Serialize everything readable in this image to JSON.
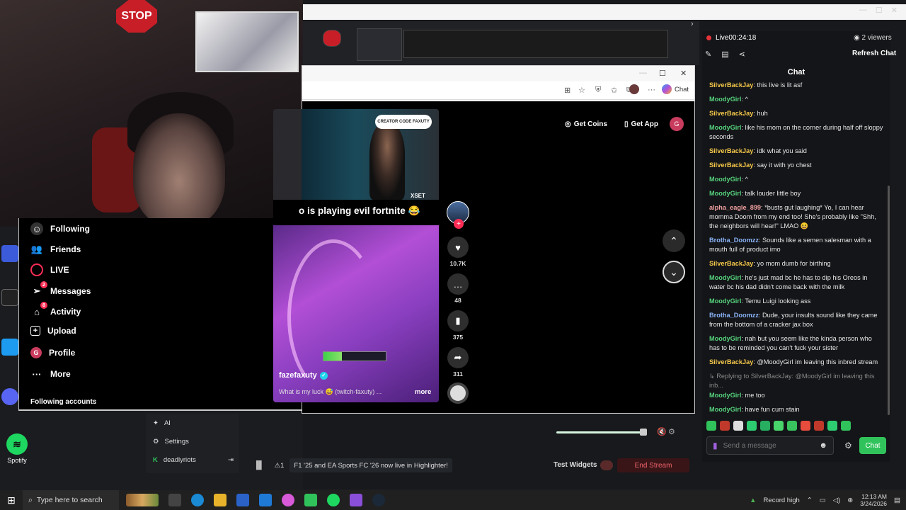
{
  "desktop": {
    "spotify_label": "Spotify",
    "webcam_sign": "STOP"
  },
  "stream": {
    "live_label": "Live",
    "live_time": "00:24:18",
    "viewers": "2 viewers",
    "refresh_label": "Refresh Chat",
    "chat_title": "Chat",
    "send_placeholder": "Send a message",
    "chat_button": "Chat",
    "test_widgets": "Test Widgets",
    "end_stream": "End Stream",
    "highlight_msg": "F1 '25 and EA Sports FC '26 now live in Highlighter!",
    "highlight_count": "1",
    "sidebar": {
      "ai_label": "AI",
      "settings_label": "Settings",
      "user_label": "deadlyriots"
    },
    "messages": [
      {
        "user": "SilverBackJay",
        "color": "#f5c84a",
        "text": "this live is lit asf"
      },
      {
        "user": "MoodyGirl",
        "color": "#55d27d",
        "text": "^"
      },
      {
        "user": "SilverBackJay",
        "color": "#f5c84a",
        "text": "huh"
      },
      {
        "user": "MoodyGirl",
        "color": "#55d27d",
        "text": "like his mom on the corner during half off sloppy seconds"
      },
      {
        "user": "SilverBackJay",
        "color": "#f5c84a",
        "text": "idk what you said"
      },
      {
        "user": "SilverBackJay",
        "color": "#f5c84a",
        "text": "say it with yo chest"
      },
      {
        "user": "MoodyGirl",
        "color": "#55d27d",
        "text": "^"
      },
      {
        "user": "MoodyGirl",
        "color": "#55d27d",
        "text": "talk louder little boy"
      },
      {
        "user": "alpha_eagle_899",
        "color": "#f0a0a0",
        "text": "*busts gut laughing* Yo, I can hear momma Doom from my end too! She's probably like \"Shh, the neighbors will hear!\" LMAO 😆"
      },
      {
        "user": "Brotha_Doomzz",
        "color": "#8ab4f8",
        "text": "Sounds like a semen salesman with a mouth full of product imo"
      },
      {
        "user": "SilverBackJay",
        "color": "#f5c84a",
        "text": "yo mom dumb for birthing"
      },
      {
        "user": "MoodyGirl",
        "color": "#55d27d",
        "text": "he's just mad bc he has to dip his Oreos in water bc his dad didn't come back with the milk"
      },
      {
        "user": "MoodyGirl",
        "color": "#55d27d",
        "text": "Temu Luigi looking ass"
      },
      {
        "user": "Brotha_Doomzz",
        "color": "#8ab4f8",
        "text": "Dude, your insults sound like they came from the bottom of a cracker jax box"
      },
      {
        "user": "MoodyGirl",
        "color": "#55d27d",
        "text": "nah but you seem like the kinda person who has to be reminded you can't fuck your sister"
      },
      {
        "user": "SilverBackJay",
        "color": "#f5c84a",
        "text": "@MoodyGirl im leaving this inbred stream"
      }
    ],
    "reply_hint": "↳ Replying to SilverBackJay: @MoodyGirl im leaving this inb...",
    "messages_after": [
      {
        "user": "MoodyGirl",
        "color": "#55d27d",
        "text": "me too"
      },
      {
        "user": "MoodyGirl",
        "color": "#55d27d",
        "text": "have fun cum stain"
      }
    ]
  },
  "tiktok": {
    "nav": {
      "following": "Following",
      "friends": "Friends",
      "live": "LIVE",
      "messages": "Messages",
      "messages_badge": "2",
      "activity": "Activity",
      "activity_badge": "8",
      "upload": "Upload",
      "profile": "Profile",
      "more": "More",
      "following_accounts": "Following accounts"
    },
    "get_coins": "Get Coins",
    "get_app": "Get App",
    "user_initial": "G",
    "video": {
      "caption": "o is playing evil fortnite 😂",
      "creator_tag": "CREATOR CODE FAXUTY",
      "brand": "XSET",
      "author": "fazefaxuty",
      "description": "What is my luck 😅 (twitch-faxuty) ...",
      "more": "more",
      "likes": "10.7K",
      "comments": "48",
      "saves": "375",
      "shares": "311"
    },
    "browser_copilot": "Chat"
  },
  "taskbar": {
    "search_placeholder": "Type here to search",
    "record_label": "Record high",
    "time": "12:13 AM",
    "date": "3/24/2026"
  },
  "colors": {
    "accent_green": "#31c35b",
    "tiktok_red": "#fe2c55",
    "end_stream_text": "#f0656a"
  }
}
